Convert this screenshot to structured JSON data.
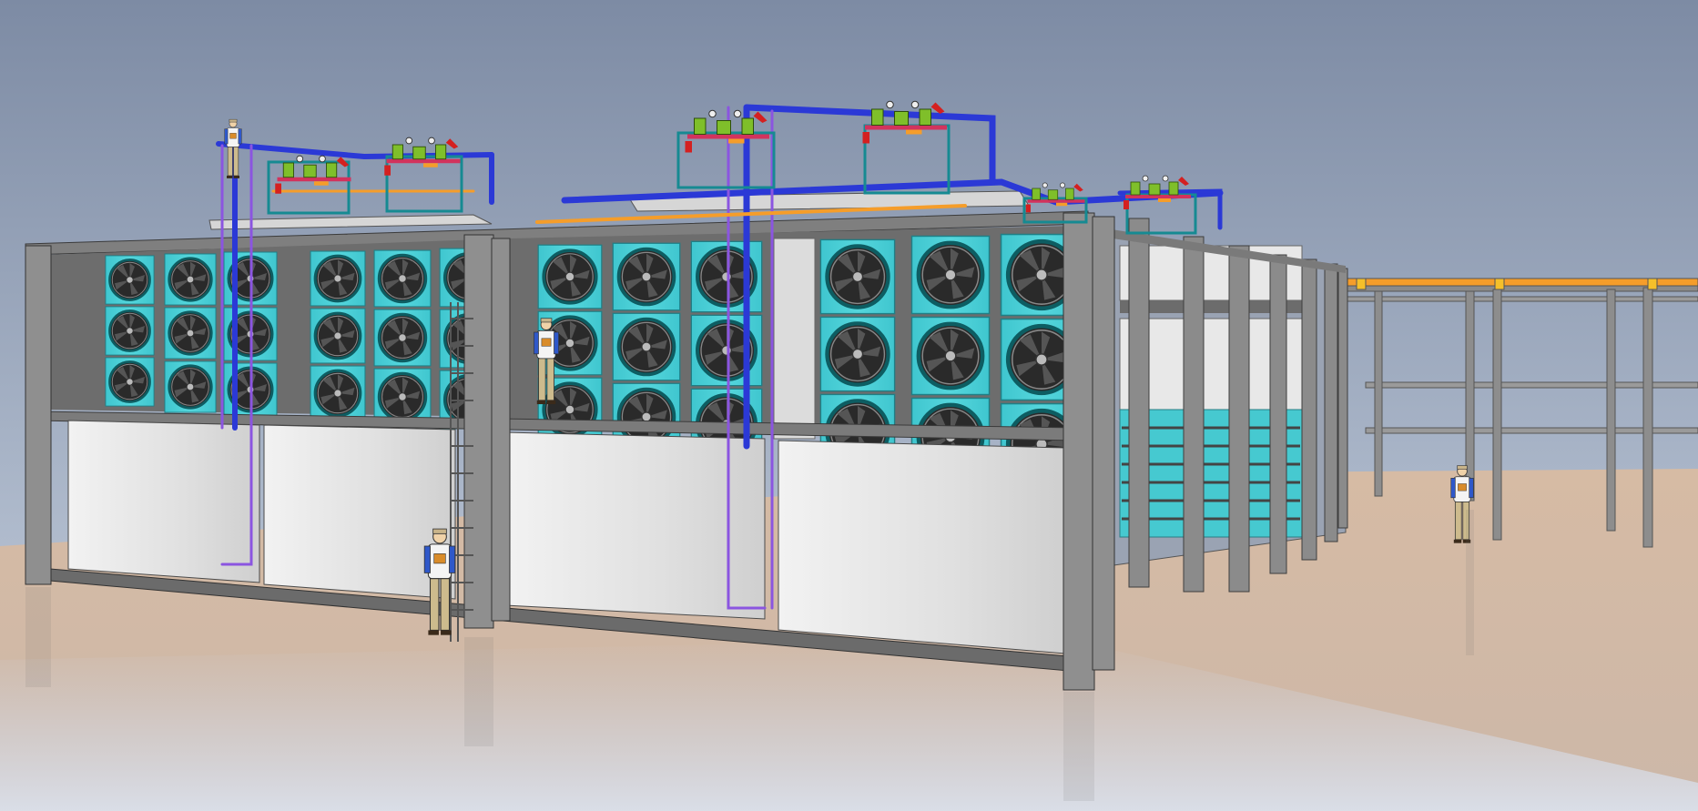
{
  "scene": {
    "background_top_color": "#7f8da6",
    "background_bottom_color": "#c7cfdd",
    "floor_color": "#d9bfa9",
    "frame_color": "#8a8a8a",
    "fan_panel_color": "#4fd0d6",
    "coil_panel_color": "#e6e6e6",
    "pipe_blue_color": "#2b39d6",
    "pipe_purple_color": "#8b55e0",
    "pipe_orange_color": "#f59d2a",
    "valve_green_color": "#7fbf2a",
    "valve_red_color": "#d42020"
  }
}
